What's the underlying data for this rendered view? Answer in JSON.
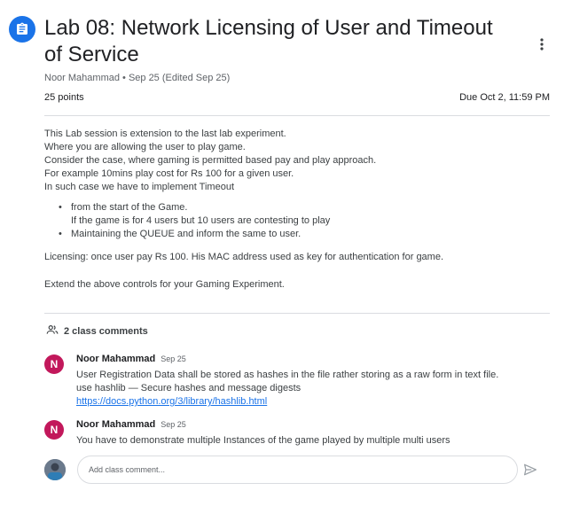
{
  "assignment": {
    "title": "Lab 08: Network Licensing of User and Timeout of Service",
    "meta": "Noor Mahammad • Sep 25 (Edited Sep 25)",
    "points": "25 points",
    "due": "Due Oct 2, 11:59 PM",
    "icon": "assignment-icon",
    "more_icon": "more-vert-icon"
  },
  "description": {
    "lines": [
      "This Lab session is extension to the last lab experiment.",
      "Where you are allowing the user to play game.",
      "Consider the case, where gaming is permitted based pay and play approach.",
      "For example 10mins play cost for Rs 100 for a given user.",
      "In such case we have to implement Timeout"
    ],
    "bullets": [
      {
        "line1": "from the start of the Game.",
        "line2": "If the game is for 4 users but 10 users are contesting to play"
      },
      {
        "line1": "Maintaining the QUEUE and inform the same to user.",
        "line2": ""
      }
    ],
    "licensing": "Licensing: once user pay Rs 100. His MAC address used as key for authentication for game.",
    "extend": "Extend the above controls for your Gaming Experiment."
  },
  "comments": {
    "header": "2 class comments",
    "icon": "people-icon",
    "items": [
      {
        "initial": "N",
        "author": "Noor Mahammad",
        "date": "Sep 25",
        "text1": "User Registration Data shall be stored as hashes in the file rather storing as a raw form in text file.",
        "text2": "use hashlib — Secure hashes and message digests",
        "link": "https://docs.python.org/3/library/hashlib.html"
      },
      {
        "initial": "N",
        "author": "Noor Mahammad",
        "date": "Sep 25",
        "text1": "You have to demonstrate multiple Instances of the game played by multiple multi users"
      }
    ]
  },
  "composer": {
    "placeholder": "Add class comment...",
    "send_icon": "send-icon"
  },
  "colors": {
    "accent": "#1a73e8",
    "comment_avatar": "#c2185b",
    "divider": "#dadce0"
  }
}
